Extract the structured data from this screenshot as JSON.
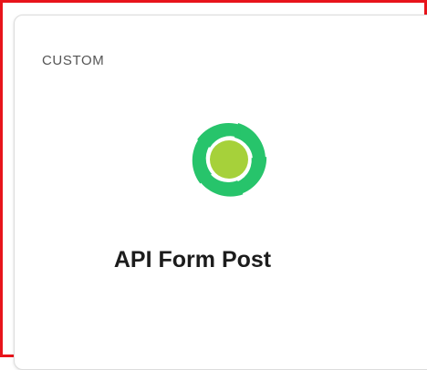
{
  "card": {
    "category_label": "CUSTOM",
    "title": "API Form Post",
    "logo_icon": "swirl-logo-icon"
  },
  "colors": {
    "highlight_border": "#e8141b",
    "logo_outer": "#27c46b",
    "logo_center": "#a6d13a",
    "title_text": "#1c1c1c",
    "label_text": "#555555"
  }
}
